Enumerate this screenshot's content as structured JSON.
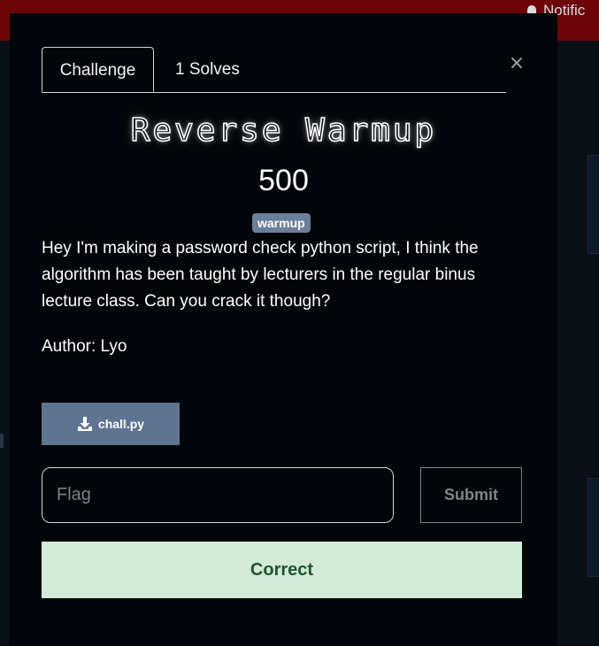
{
  "background": {
    "notification_label": "Notific"
  },
  "modal": {
    "tabs": [
      {
        "label": "Challenge",
        "active": true
      },
      {
        "label": "1 Solves",
        "active": false
      }
    ],
    "close_glyph": "×",
    "challenge": {
      "name": "Reverse Warmup",
      "points": "500",
      "tag": "warmup",
      "description": "Hey I'm making a password check python script, I think the algorithm has been taught by lecturers in the regular binus lecture class. Can you crack it though?",
      "author": "Author: Lyo",
      "file": {
        "label": "chall.py",
        "icon": "download-icon"
      }
    },
    "flag_input": {
      "placeholder": "Flag",
      "value": ""
    },
    "submit_label": "Submit",
    "result_label": "Correct"
  },
  "colors": {
    "topbar": "#6b0508",
    "modal_bg": "#020509",
    "tag_bg": "#6b7f9c",
    "file_button": "#5f7491",
    "success_bg": "#d3ead9",
    "success_text": "#1d5630"
  }
}
